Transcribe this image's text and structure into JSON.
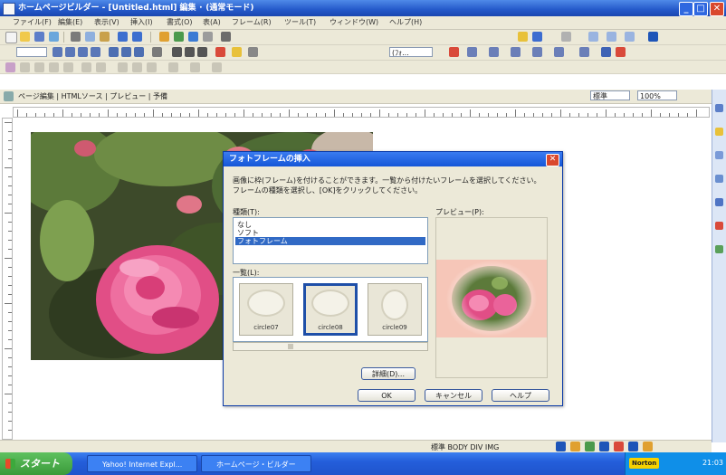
{
  "window": {
    "title": "ホームページビルダー - [Untitled.html]  編集 ･ (通常モード)",
    "min_label": "_",
    "max_label": "□",
    "close_label": "✕"
  },
  "menu": [
    "ファイル(F)",
    "編集(E)",
    "表示(V)",
    "挿入(I)",
    "書式(O)",
    "表(A)",
    "フレーム(R)",
    "ツール(T)",
    "ウィンドウ(W)",
    "ヘルプ(H)"
  ],
  "toolbar2": {
    "font_combo": "",
    "size_combo": "(ﾌｫ..."
  },
  "viewbar": {
    "address": "ページ編集 | HTMLソース | プレビュー | 予備",
    "zoom_combo": "標準",
    "size_combo": "100%"
  },
  "dialog": {
    "title": "フォトフレームの挿入",
    "close_label": "✕",
    "description_line1": "画像に枠(フレーム)を付けることができます。一覧から付けたいフレームを選択してください。",
    "description_line2": "フレームの種類を選択し、[OK]をクリックしてください。",
    "type_label": "種類(T):",
    "types": [
      "なし",
      "ソフト",
      "フォトフレーム"
    ],
    "selected_type_index": 2,
    "list_label": "一覧(L):",
    "thumbnails": [
      "circle07",
      "circle08",
      "circle09"
    ],
    "selected_thumbnail_index": 1,
    "preview_label": "プレビュー(P):",
    "detail_button": "詳細(D)...",
    "ok_button": "OK",
    "cancel_button": "キャンセル",
    "help_button": "ヘルプ"
  },
  "statusbar": {
    "text": "標準  BODY  DIV  IMG"
  },
  "taskbar": {
    "start_label": "スタート",
    "items": [
      "Yahoo! Internet Expl...",
      "ホームページ・ビルダー"
    ],
    "norton_label": "Norton",
    "clock": "21:03"
  },
  "colors": {
    "accent": "#245edb",
    "dialog_title": "#1557d8",
    "close_red": "#d9482d",
    "selection": "#316ac5"
  }
}
